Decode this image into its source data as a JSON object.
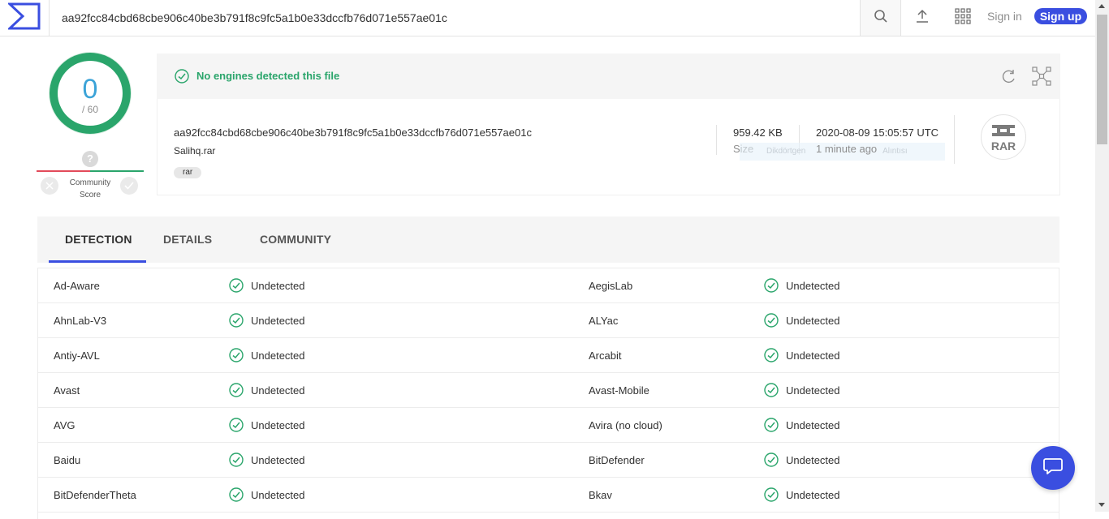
{
  "topbar": {
    "search_value": "aa92fcc84cbd68cbe906c40be3b791f8c9fc5a1b0e33dccfb76d071e557ae01c",
    "sign_in": "Sign in",
    "sign_up": "Sign up"
  },
  "score": {
    "detections": "0",
    "total": "/ 60",
    "community_label_line1": "Community",
    "community_label_line2": "Score",
    "community_unknown": "?"
  },
  "summary": {
    "status": "No engines detected this file",
    "hash": "aa92fcc84cbd68cbe906c40be3b791f8c9fc5a1b0e33dccfb76d071e557ae01c",
    "filename": "Salihq.rar",
    "tag": "rar",
    "size_value": "959.42 KB",
    "size_label": "Size",
    "date_value": "2020-08-09 15:05:57 UTC",
    "date_relative": "1 minute ago",
    "tooltip_text": "Dikdörtgen",
    "tooltip_text2": "Alıntısı",
    "file_type": "RAR"
  },
  "tabs": [
    {
      "label": "DETECTION"
    },
    {
      "label": "DETAILS"
    },
    {
      "label": "COMMUNITY"
    }
  ],
  "detections": [
    {
      "left": {
        "engine": "Ad-Aware",
        "result": "Undetected"
      },
      "right": {
        "engine": "AegisLab",
        "result": "Undetected"
      }
    },
    {
      "left": {
        "engine": "AhnLab-V3",
        "result": "Undetected"
      },
      "right": {
        "engine": "ALYac",
        "result": "Undetected"
      }
    },
    {
      "left": {
        "engine": "Antiy-AVL",
        "result": "Undetected"
      },
      "right": {
        "engine": "Arcabit",
        "result": "Undetected"
      }
    },
    {
      "left": {
        "engine": "Avast",
        "result": "Undetected"
      },
      "right": {
        "engine": "Avast-Mobile",
        "result": "Undetected"
      }
    },
    {
      "left": {
        "engine": "AVG",
        "result": "Undetected"
      },
      "right": {
        "engine": "Avira (no cloud)",
        "result": "Undetected"
      }
    },
    {
      "left": {
        "engine": "Baidu",
        "result": "Undetected"
      },
      "right": {
        "engine": "BitDefender",
        "result": "Undetected"
      }
    },
    {
      "left": {
        "engine": "BitDefenderTheta",
        "result": "Undetected"
      },
      "right": {
        "engine": "Bkav",
        "result": "Undetected"
      }
    }
  ],
  "colors": {
    "accent": "#3a4ee0",
    "clean": "#2aa56b",
    "malicious": "#e24a5a"
  },
  "icons": {
    "logo": "virustotal-logo-icon",
    "search": "search-icon",
    "upload": "upload-icon",
    "apps": "apps-grid-icon",
    "reload": "reload-icon",
    "graph": "graph-expand-icon",
    "chat": "chat-icon",
    "clean": "check-circle-icon"
  }
}
